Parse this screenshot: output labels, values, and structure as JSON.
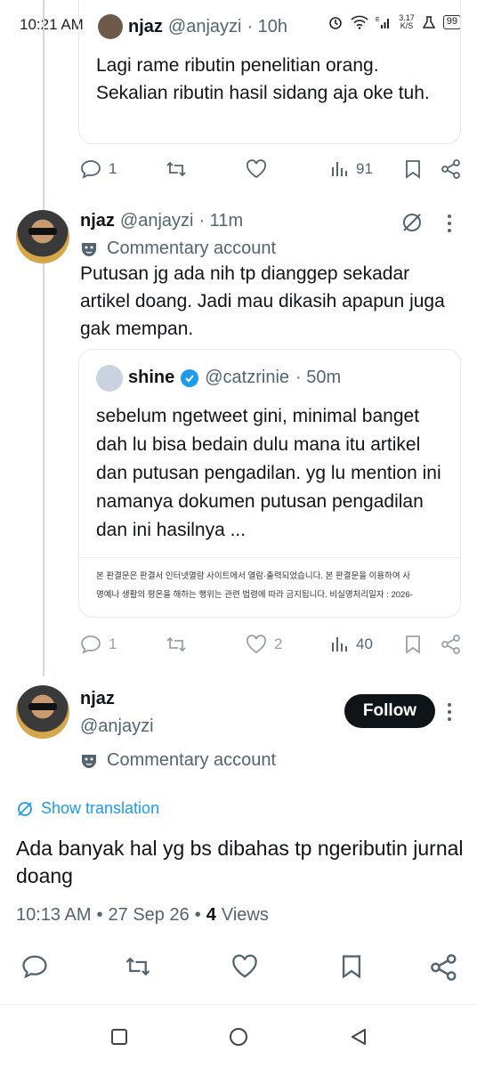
{
  "status_bar": {
    "time": "10:21 AM",
    "net_speed": "3.17\nK/S",
    "battery": "99"
  },
  "ghost_header": {
    "name": "njaz",
    "handle": "@anjayzi",
    "time": "· 10h"
  },
  "top_card": {
    "text": "Lagi rame ributin penelitian orang. Sekalian ributin hasil sidang aja oke tuh."
  },
  "top_actions": {
    "replies": "1",
    "retweets": "",
    "likes": "",
    "views": "91"
  },
  "reply_tweet": {
    "name": "njaz",
    "handle": "@anjayzi",
    "time": "· 11m",
    "label": "Commentary account",
    "text": "Putusan jg ada nih tp dianggep sekadar artikel doang. Jadi mau dikasih apapun juga gak mempan."
  },
  "quoted": {
    "name": "shine",
    "handle": "@catzrinie",
    "time": "· 50m",
    "text": "sebelum ngetweet gini, minimal banget dah lu bisa bedain dulu mana itu artikel dan putusan pengadilan. yg lu mention ini namanya dokumen putusan pengadilan dan ini hasilnya ...",
    "korean_line1": "본 판결문은 판결서 인터넷열람 사이트에서 열람·출력되었습니다. 본 판결문을 이용하여 사",
    "korean_line2": "명예나 생활의 평온을 해하는 행위는 관련 법령에 따라 금지됩니다. 비실명처리일자 : 2026-"
  },
  "reply_actions": {
    "replies": "1",
    "retweets": "",
    "likes": "2",
    "views": "40"
  },
  "main_tweet": {
    "name": "njaz",
    "handle": "@anjayzi",
    "follow_label": "Follow",
    "label": "Commentary account",
    "show_translation": "Show translation",
    "text": "Ada banyak hal yg bs dibahas tp ngeributin jurnal doang",
    "time": "10:13 AM",
    "date": "27 Sep 26",
    "views_count": "4",
    "views_label": "Views"
  },
  "icons": [
    "reply-icon",
    "retweet-icon",
    "like-icon",
    "views-icon",
    "bookmark-icon",
    "share-icon",
    "grok-icon",
    "more-icon",
    "mask-icon",
    "translate-icon"
  ],
  "colors": {
    "accent": "#1d9bf0",
    "text": "#0f1419",
    "muted": "#536471",
    "button": "#0f1419"
  }
}
